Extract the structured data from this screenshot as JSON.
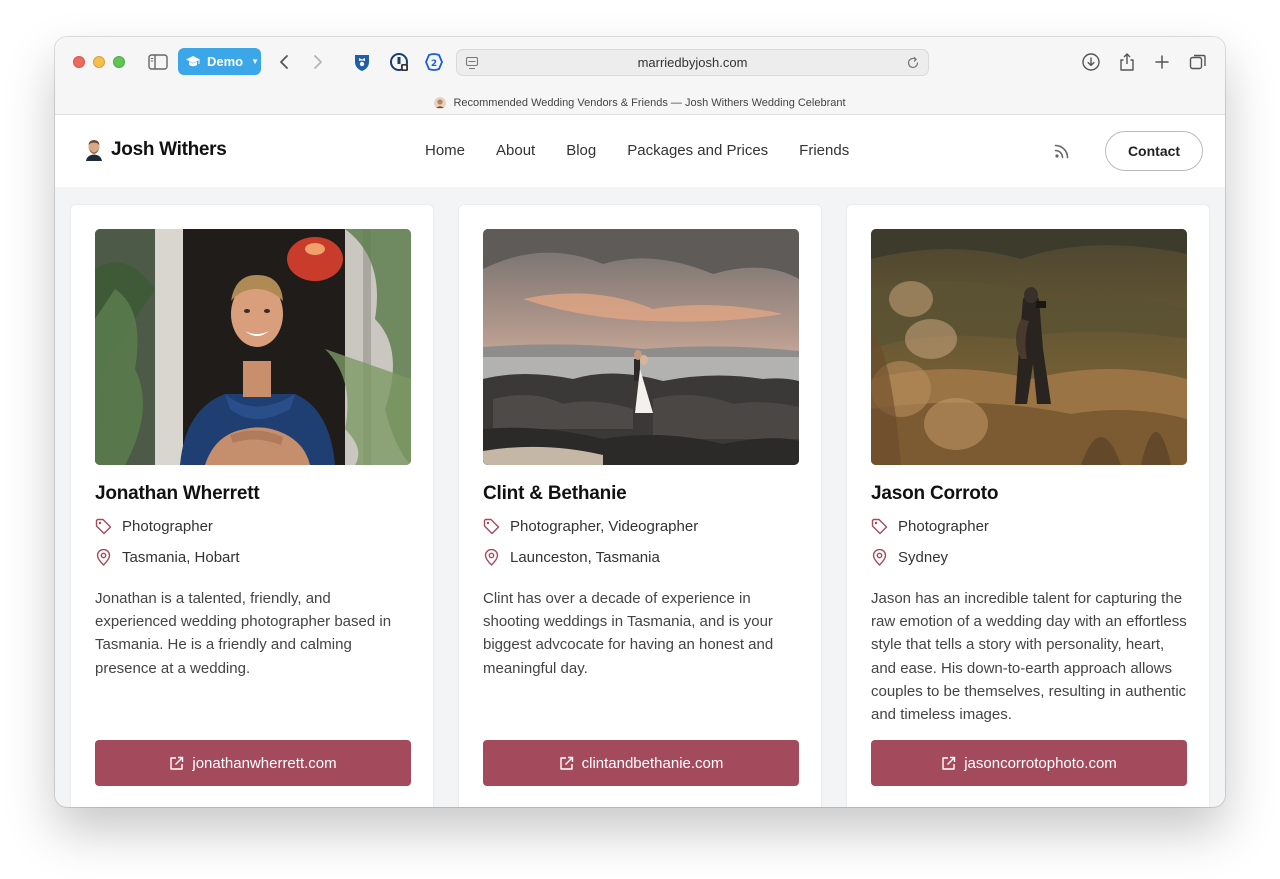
{
  "browser": {
    "profile_label": "Demo",
    "address": "marriedbyjosh.com",
    "tab_title": "Recommended Wedding Vendors & Friends — Josh Withers Wedding Celebrant"
  },
  "site": {
    "logo_text": "Josh Withers",
    "nav": [
      "Home",
      "About",
      "Blog",
      "Packages and Prices",
      "Friends"
    ],
    "contact_label": "Contact"
  },
  "colors": {
    "accent": "#a44a5d",
    "profile_pill": "#3ba6e8"
  },
  "vendors": [
    {
      "name": "Jonathan Wherrett",
      "category": "Photographer",
      "location": "Tasmania, Hobart",
      "description": "Jonathan is a talented, friendly, and experienced wedding photographer based in Tasmania. He is a friendly and calming presence at a wedding.",
      "website": "jonathanwherrett.com"
    },
    {
      "name": "Clint & Bethanie",
      "category": "Photographer, Videographer",
      "location": "Launceston, Tasmania",
      "description": "Clint has over a decade of experience in shooting weddings in Tasmania, and is your biggest advcocate for having an honest and meaningful day.",
      "website": "clintandbethanie.com"
    },
    {
      "name": "Jason Corroto",
      "category": "Photographer",
      "location": "Sydney",
      "description": "Jason has an incredible talent for capturing the raw emotion of a wedding day with an effortless style that tells a story with personality, heart, and ease. His down-to-earth approach allows couples to be themselves, resulting in authentic and timeless images.",
      "website": "jasoncorrotophoto.com"
    }
  ]
}
